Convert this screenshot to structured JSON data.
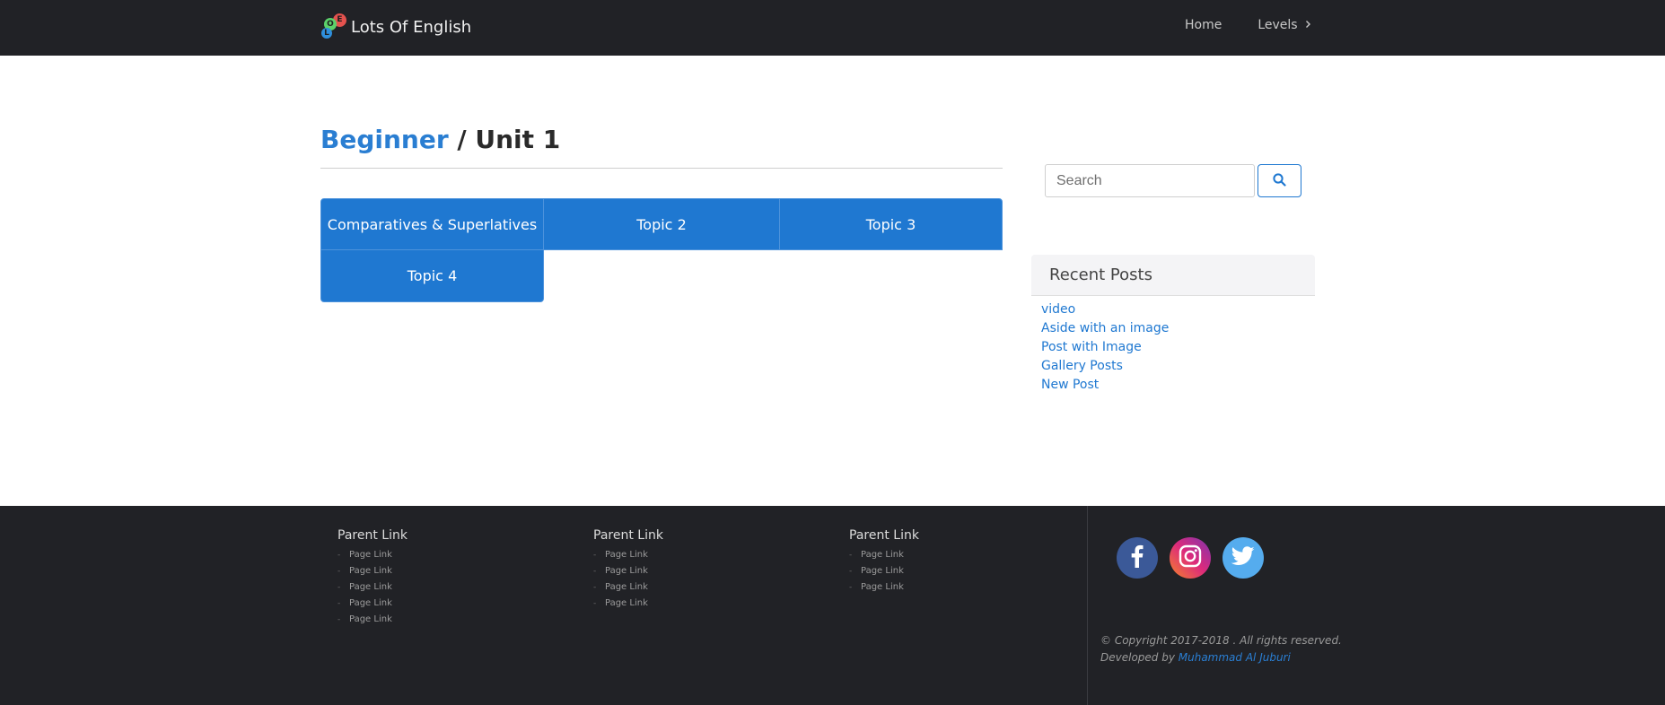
{
  "navbar": {
    "logo_letters": [
      "E",
      "O",
      "L"
    ],
    "brand": "Lots Of English",
    "links": [
      {
        "label": "Home"
      },
      {
        "label": "Levels",
        "icon": "chevron-right-icon"
      }
    ]
  },
  "main": {
    "breadcrumb_link": "Beginner",
    "breadcrumb_separator": " / ",
    "breadcrumb_current": "Unit 1",
    "topics": [
      "Comparatives & Superlatives",
      "Topic 2",
      "Topic 3",
      "Topic 4"
    ]
  },
  "sidebar": {
    "search_placeholder": "Search",
    "search_icon": "search-icon",
    "recent_title": "Recent Posts",
    "recent_posts": [
      "video",
      "Aside with an image",
      "Post with Image",
      "Gallery Posts",
      "New Post"
    ]
  },
  "footer": {
    "columns": [
      {
        "title": "Parent Link",
        "links": [
          "Page Link",
          "Page Link",
          "Page Link",
          "Page Link",
          "Page Link"
        ]
      },
      {
        "title": "Parent Link",
        "links": [
          "Page Link",
          "Page Link",
          "Page Link",
          "Page Link"
        ]
      },
      {
        "title": "Parent Link",
        "links": [
          "Page Link",
          "Page Link",
          "Page Link"
        ]
      }
    ],
    "social": [
      "facebook-icon",
      "instagram-icon",
      "twitter-icon"
    ],
    "copyright": "© Copyright 2017-2018 . All rights reserved.",
    "developed_by": "Developed by ",
    "developer": "Muhammad Al Juburi"
  },
  "colors": {
    "navbar_bg": "#212226",
    "accent": "#1f78d1",
    "footer_bg": "#212226"
  }
}
